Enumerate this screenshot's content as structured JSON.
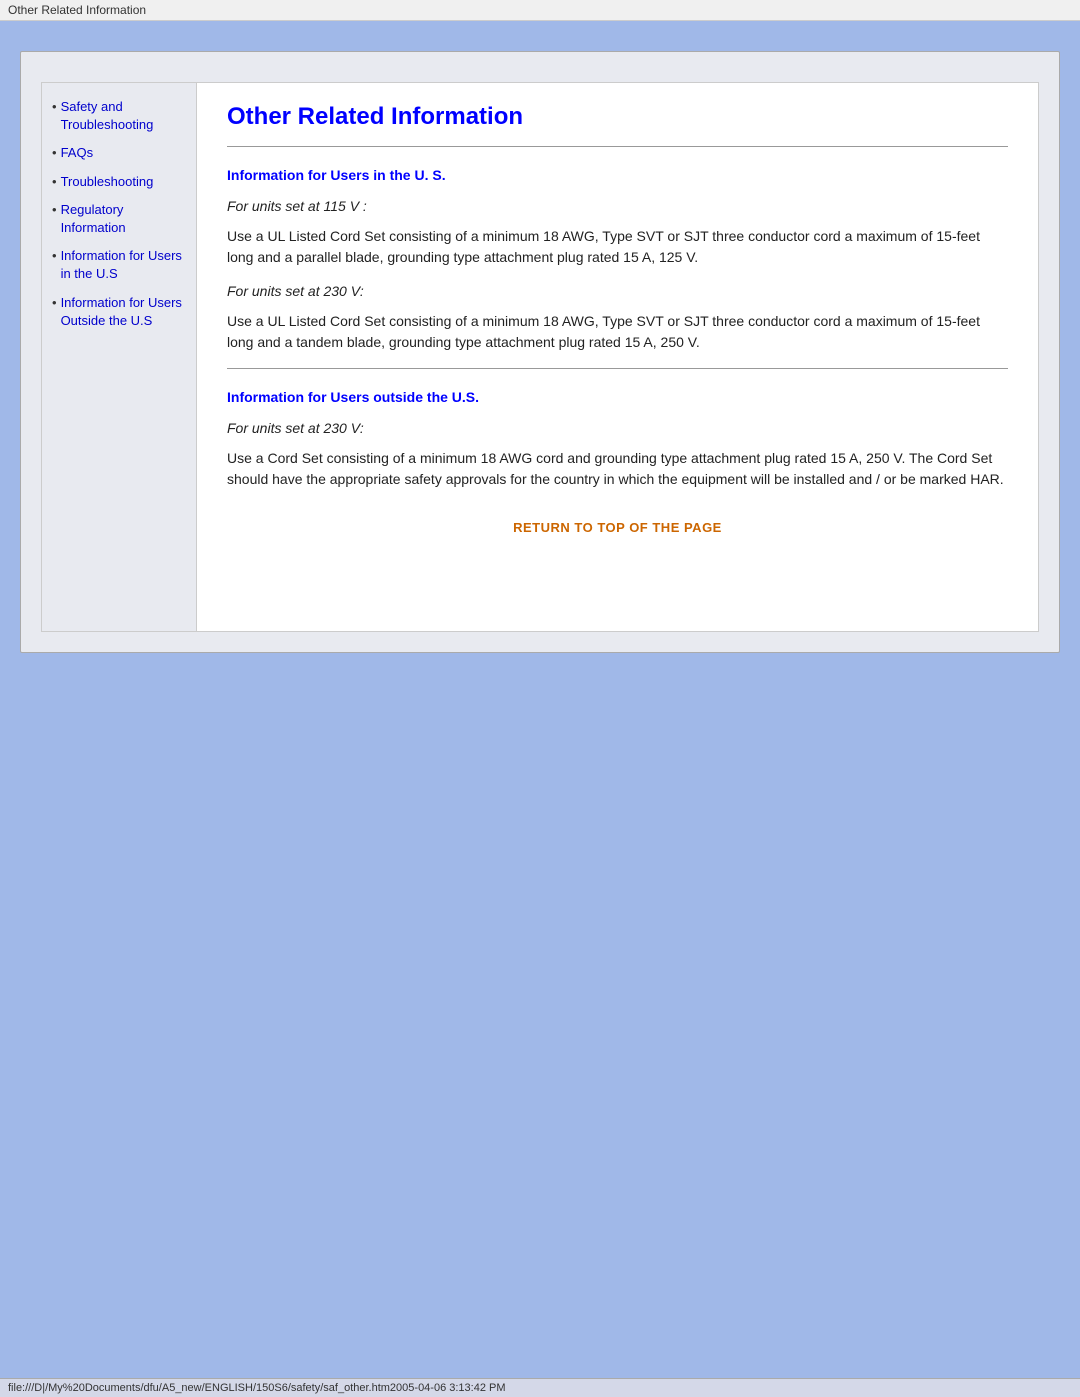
{
  "titleBar": {
    "text": "Other Related Information"
  },
  "sidebar": {
    "items": [
      {
        "label": "Safety and Troubleshooting",
        "href": "#"
      },
      {
        "label": "FAQs",
        "href": "#"
      },
      {
        "label": "Troubleshooting",
        "href": "#"
      },
      {
        "label": "Regulatory Information",
        "href": "#"
      },
      {
        "label": "Information for Users in the U.S",
        "href": "#"
      },
      {
        "label": "Information for Users Outside the U.S",
        "href": "#"
      }
    ]
  },
  "main": {
    "pageTitle": "Other Related Information",
    "section1": {
      "title": "Information for Users in the U. S.",
      "block1": {
        "italic": "For units set at 115 V :",
        "body": "Use a UL Listed Cord Set consisting of a minimum 18 AWG, Type SVT or SJT three conductor cord a maximum of 15-feet long and a parallel blade, grounding type attachment plug rated 15 A, 125 V."
      },
      "block2": {
        "italic": "For units set at 230 V:",
        "body": "Use a UL Listed Cord Set consisting of a minimum 18 AWG, Type SVT or SJT three conductor cord a maximum of 15-feet long and a tandem blade, grounding type attachment plug rated 15 A, 250 V."
      }
    },
    "section2": {
      "title": "Information for Users outside the U.S.",
      "block1": {
        "italic": "For units set at 230 V:",
        "body": "Use a Cord Set consisting of a minimum 18 AWG cord and grounding type attachment plug rated 15 A, 250 V. The Cord Set should have the appropriate safety approvals for the country in which the equipment will be installed and / or be marked HAR."
      }
    },
    "returnLink": "RETURN TO TOP OF THE PAGE"
  },
  "statusBar": {
    "text": "file:///D|/My%20Documents/dfu/A5_new/ENGLISH/150S6/safety/saf_other.htm2005-04-06  3:13:42 PM"
  }
}
